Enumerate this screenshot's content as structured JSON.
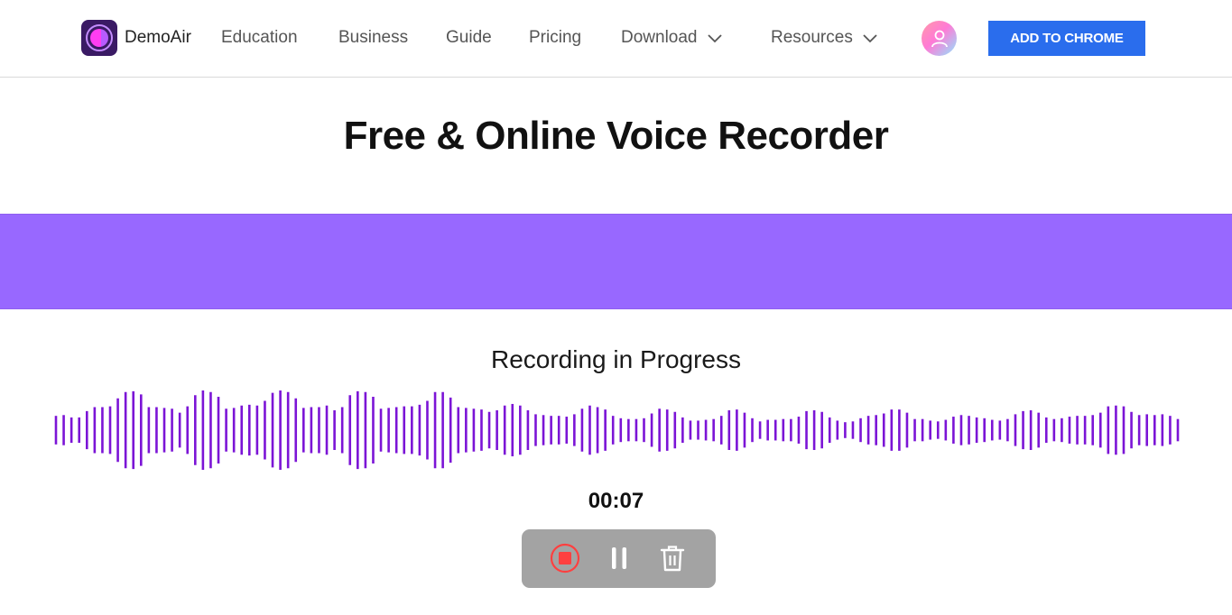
{
  "header": {
    "brand": "DemoAir",
    "nav": [
      {
        "label": "Education",
        "dropdown": false
      },
      {
        "label": "Business",
        "dropdown": false
      },
      {
        "label": "Guide",
        "dropdown": false
      },
      {
        "label": "Pricing",
        "dropdown": false
      },
      {
        "label": "Download",
        "dropdown": true
      },
      {
        "label": "Resources",
        "dropdown": true
      }
    ],
    "avatar_icon": "user-icon",
    "cta_label": "ADD TO CHROME"
  },
  "colors": {
    "accent_purple": "#9868ff",
    "wave_bar": "#7b14d6",
    "cta_blue": "#2a6ded",
    "record_red": "#ff4040",
    "control_bg": "#a3a3a3"
  },
  "page": {
    "title": "Free & Online Voice Recorder",
    "status": "Recording in Progress",
    "timer": "00:07"
  },
  "waveform": {
    "amplitudes": [
      0.36,
      0.38,
      0.32,
      0.32,
      0.48,
      0.58,
      0.58,
      0.6,
      0.8,
      0.96,
      0.98,
      0.9,
      0.58,
      0.58,
      0.56,
      0.54,
      0.44,
      0.6,
      0.88,
      1.0,
      0.96,
      0.84,
      0.54,
      0.56,
      0.62,
      0.64,
      0.62,
      0.74,
      0.94,
      1.0,
      0.96,
      0.8,
      0.56,
      0.58,
      0.58,
      0.62,
      0.5,
      0.58,
      0.88,
      0.98,
      0.96,
      0.84,
      0.54,
      0.56,
      0.58,
      0.6,
      0.6,
      0.64,
      0.74,
      0.96,
      0.96,
      0.82,
      0.58,
      0.56,
      0.54,
      0.52,
      0.46,
      0.5,
      0.62,
      0.66,
      0.62,
      0.5,
      0.4,
      0.38,
      0.36,
      0.36,
      0.34,
      0.4,
      0.54,
      0.62,
      0.58,
      0.52,
      0.36,
      0.3,
      0.28,
      0.28,
      0.3,
      0.42,
      0.54,
      0.52,
      0.46,
      0.32,
      0.24,
      0.24,
      0.26,
      0.28,
      0.36,
      0.5,
      0.52,
      0.44,
      0.3,
      0.22,
      0.26,
      0.26,
      0.28,
      0.28,
      0.34,
      0.48,
      0.5,
      0.46,
      0.32,
      0.24,
      0.2,
      0.22,
      0.3,
      0.36,
      0.38,
      0.42,
      0.52,
      0.52,
      0.44,
      0.28,
      0.28,
      0.24,
      0.22,
      0.26,
      0.34,
      0.38,
      0.36,
      0.32,
      0.3,
      0.26,
      0.24,
      0.28,
      0.4,
      0.48,
      0.5,
      0.44,
      0.32,
      0.28,
      0.3,
      0.34,
      0.36,
      0.36,
      0.38,
      0.44,
      0.6,
      0.62,
      0.6,
      0.46,
      0.38,
      0.4,
      0.38,
      0.4,
      0.36,
      0.28
    ]
  },
  "controls": [
    {
      "name": "stop",
      "icon": "stop-record-icon"
    },
    {
      "name": "pause",
      "icon": "pause-icon"
    },
    {
      "name": "delete",
      "icon": "trash-icon"
    }
  ]
}
